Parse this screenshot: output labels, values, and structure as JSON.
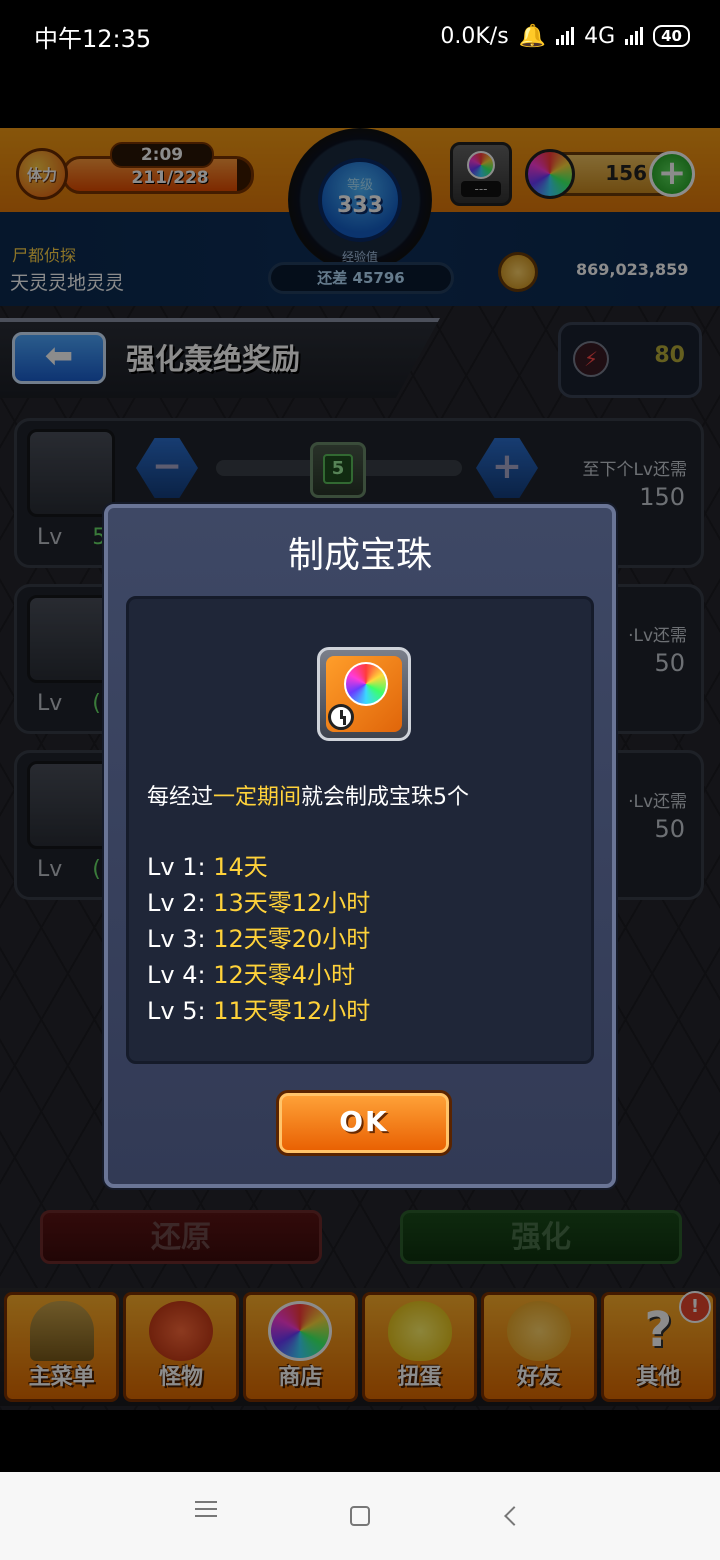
{
  "status_bar": {
    "time": "中午12:35",
    "net_speed": "0.0K/s",
    "network": "4G",
    "battery": "40"
  },
  "header": {
    "stamina_label": "体力",
    "stamina_timer": "2:09",
    "stamina_value": "211/228",
    "stamina_fraction": 0.925,
    "level_label": "等级",
    "level_value": "333",
    "exp_label": "经验值",
    "exp_remaining": "还差 45796",
    "gem_slot_placeholder": "---",
    "orb_count": "156",
    "player_title": "尸都侦探",
    "player_name": "天灵灵地灵灵",
    "coins": "869,023,859"
  },
  "title_bar": {
    "title": "强化轰绝奖励",
    "energy_value": "80"
  },
  "rows": [
    {
      "lv_label": "Lv",
      "lv_value": "5",
      "need_label": "至下个Lv还需",
      "need_value": "150"
    },
    {
      "lv_label": "Lv",
      "lv_value": "(",
      "need_label": "·Lv还需",
      "need_value": "50"
    },
    {
      "lv_label": "Lv",
      "lv_value": "(",
      "need_label": "·Lv还需",
      "need_value": "50"
    }
  ],
  "stepper": {
    "value": "5"
  },
  "actions": {
    "restore_label": "还原",
    "enhance_label": "强化"
  },
  "bottom_nav": [
    {
      "label": "主菜单",
      "icon": "castle-gate-icon"
    },
    {
      "label": "怪物",
      "icon": "monster-icon"
    },
    {
      "label": "商店",
      "icon": "orb-shop-icon"
    },
    {
      "label": "扭蛋",
      "icon": "egg-icon"
    },
    {
      "label": "好友",
      "icon": "friends-icon"
    },
    {
      "label": "其他",
      "icon": "question-mark-icon",
      "badge": "!"
    }
  ],
  "modal": {
    "title": "制成宝珠",
    "desc_prefix": "每经过",
    "desc_highlight": "一定期间",
    "desc_suffix": "就会制成宝珠5个",
    "levels": [
      {
        "key": "Lv 1:",
        "value": "14天"
      },
      {
        "key": "Lv 2:",
        "value": "13天零12小时"
      },
      {
        "key": "Lv 3:",
        "value": "12天零20小时"
      },
      {
        "key": "Lv 4:",
        "value": "12天零4小时"
      },
      {
        "key": "Lv 5:",
        "value": "11天零12小时"
      }
    ],
    "ok_label": "OK"
  },
  "colors": {
    "highlight": "#ffd23a",
    "header_orange": "#f59c14",
    "modal_bg": "#323a55"
  }
}
